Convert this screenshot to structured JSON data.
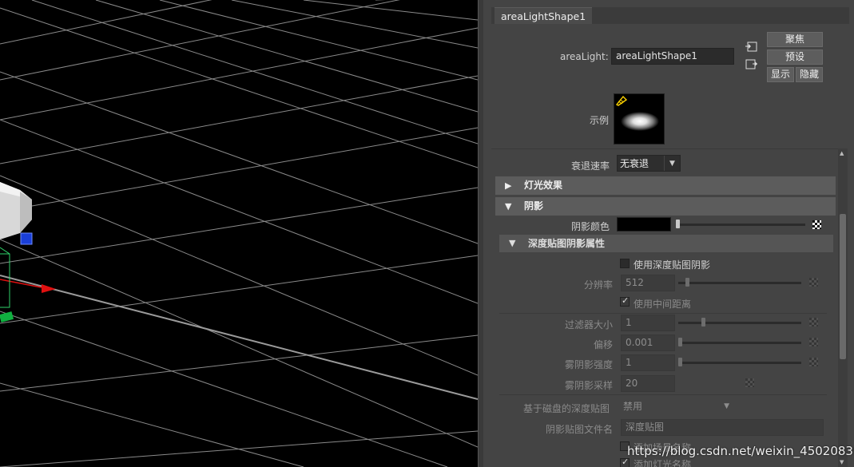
{
  "viewport": {
    "background": "#000000",
    "grid_color": "#8a8a8a"
  },
  "panel": {
    "tab_label": "areaLightShape1",
    "node_label": "areaLight:",
    "node_value": "areaLightShape1",
    "buttons": {
      "focus": "聚焦",
      "presets": "预设",
      "show": "显示",
      "hide": "隐藏"
    },
    "sample_label": "示例",
    "decay_label": "衰退速率",
    "decay_value": "无衰退",
    "sections": {
      "light_effects": "灯光效果",
      "shadows": "阴影"
    },
    "shadow_color_label": "阴影颜色",
    "shadow_color": "#000000",
    "depth_map": {
      "title": "深度贴图阴影属性",
      "use_depth_map": "使用深度贴图阴影",
      "resolution_label": "分辨率",
      "resolution_value": "512",
      "use_mid_dist": "使用中间距离",
      "filter_size_label": "过滤器大小",
      "filter_size_value": "1",
      "bias_label": "偏移",
      "bias_value": "0.001",
      "fog_intensity_label": "雾阴影强度",
      "fog_intensity_value": "1",
      "fog_samples_label": "雾阴影采样",
      "fog_samples_value": "20",
      "disk_map_label": "基于磁盘的深度贴图",
      "disk_map_value": "禁用",
      "filename_label": "阴影贴图文件名",
      "filename_value": "深度贴图",
      "add_scene_name": "添加场景名称",
      "add_light_name": "添加灯光名称"
    }
  },
  "watermark": "https://blog.csdn.net/weixin_45020839"
}
